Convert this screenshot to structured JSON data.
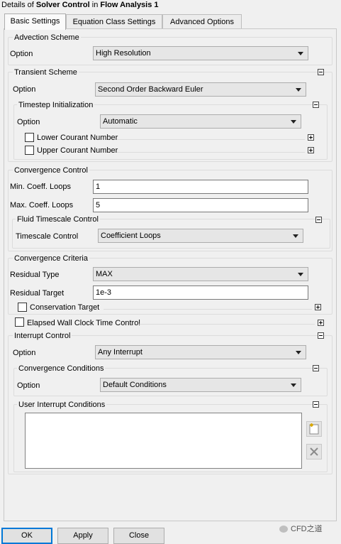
{
  "window": {
    "title_prefix": "Details of ",
    "title_object": "Solver Control",
    "title_mid": " in ",
    "title_context": "Flow Analysis 1"
  },
  "tabs": [
    {
      "label": "Basic Settings",
      "active": true
    },
    {
      "label": "Equation Class Settings",
      "active": false
    },
    {
      "label": "Advanced Options",
      "active": false
    }
  ],
  "advection": {
    "group_label": "Advection Scheme",
    "option_label": "Option",
    "option_value": "High Resolution"
  },
  "transient": {
    "group_label": "Transient Scheme",
    "option_label": "Option",
    "option_value": "Second Order Backward Euler",
    "timestep": {
      "group_label": "Timestep Initialization",
      "option_label": "Option",
      "option_value": "Automatic",
      "lower_courant_label": "Lower Courant Number",
      "upper_courant_label": "Upper Courant Number"
    }
  },
  "convergence_control": {
    "group_label": "Convergence Control",
    "min_loops_label": "Min. Coeff. Loops",
    "min_loops_value": "1",
    "max_loops_label": "Max. Coeff. Loops",
    "max_loops_value": "5",
    "fluid_timescale": {
      "group_label": "Fluid Timescale Control",
      "timescale_label": "Timescale Control",
      "timescale_value": "Coefficient Loops"
    }
  },
  "convergence_criteria": {
    "group_label": "Convergence Criteria",
    "residual_type_label": "Residual Type",
    "residual_type_value": "MAX",
    "residual_target_label": "Residual Target",
    "residual_target_value": "1e-3",
    "conservation_target_label": "Conservation Target"
  },
  "elapsed_wall_clock_label": "Elapsed Wall Clock Time Control",
  "interrupt": {
    "group_label": "Interrupt Control",
    "option_label": "Option",
    "option_value": "Any Interrupt",
    "convergence_conditions": {
      "group_label": "Convergence Conditions",
      "option_label": "Option",
      "option_value": "Default Conditions"
    },
    "user_conditions_label": "User Interrupt Conditions"
  },
  "buttons": {
    "ok": "OK",
    "apply": "Apply",
    "close": "Close"
  },
  "watermark": "CFD之道"
}
